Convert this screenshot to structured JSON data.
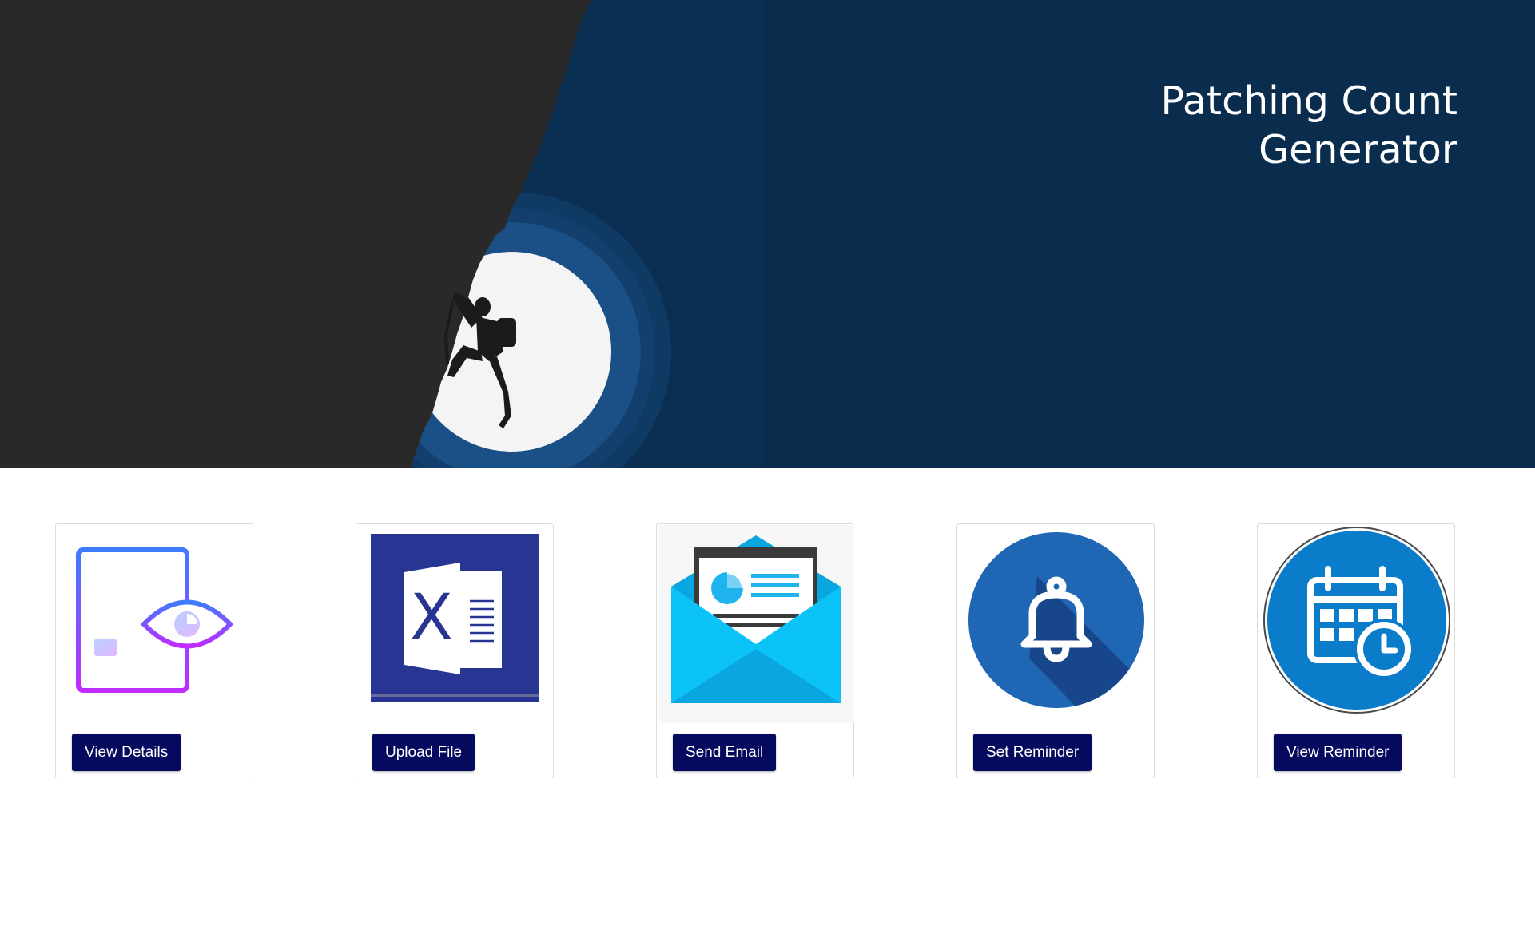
{
  "hero": {
    "title_line1": "Patching Count",
    "title_line2": "Generator",
    "background_left": "#292929",
    "background_right": "#0b2f52",
    "moon": "#f4f4f4"
  },
  "cards": [
    {
      "label": "View Details",
      "icon": "document-eye-icon"
    },
    {
      "label": "Upload File",
      "icon": "excel-icon"
    },
    {
      "label": "Send Email",
      "icon": "email-newsletter-icon"
    },
    {
      "label": "Set Reminder",
      "icon": "bell-icon"
    },
    {
      "label": "View Reminder",
      "icon": "calendar-clock-icon"
    }
  ],
  "colors": {
    "button_bg": "#050a5e",
    "button_text": "#ffffff",
    "card_border": "#dcdcdc"
  }
}
